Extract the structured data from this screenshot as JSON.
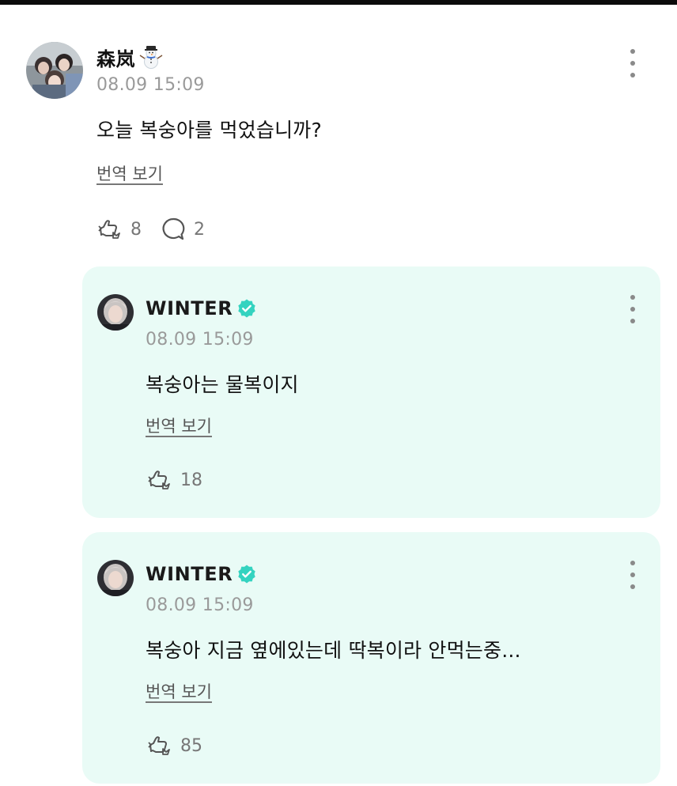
{
  "post": {
    "author": "森岚",
    "author_emoji": "snowman-icon",
    "time": "08.09 15:09",
    "text": "오늘 복숭아를 먹었습니까?",
    "translate": "번역 보기",
    "like_count": "8",
    "comment_count": "2"
  },
  "replies": [
    {
      "author": "WINTER",
      "verified": true,
      "time": "08.09 15:09",
      "text": "복숭아는 물복이지",
      "translate": "번역 보기",
      "like_count": "18"
    },
    {
      "author": "WINTER",
      "verified": true,
      "time": "08.09 15:09",
      "text": "복숭아 지금 옆에있는데 딱복이라 안먹는중...",
      "translate": "번역 보기",
      "like_count": "85"
    }
  ],
  "colors": {
    "reply_background": "#e9fbf6",
    "verified_badge": "#34d3c0",
    "timestamp": "#9a9a9a"
  }
}
